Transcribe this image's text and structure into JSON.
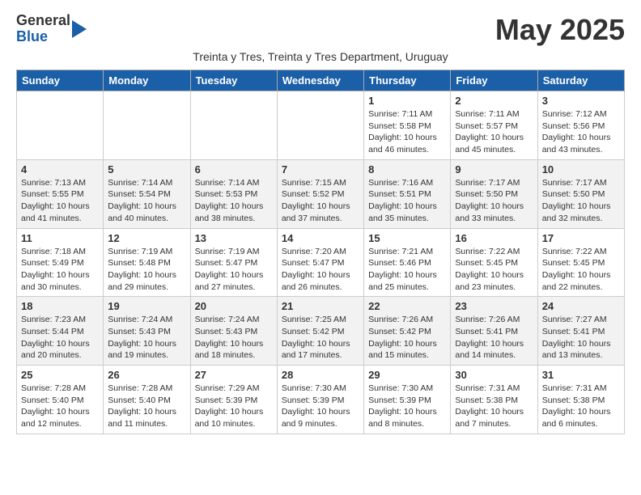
{
  "header": {
    "logo_general": "General",
    "logo_blue": "Blue",
    "month_title": "May 2025",
    "subtitle": "Treinta y Tres, Treinta y Tres Department, Uruguay"
  },
  "days_of_week": [
    "Sunday",
    "Monday",
    "Tuesday",
    "Wednesday",
    "Thursday",
    "Friday",
    "Saturday"
  ],
  "weeks": [
    [
      {
        "day": "",
        "info": ""
      },
      {
        "day": "",
        "info": ""
      },
      {
        "day": "",
        "info": ""
      },
      {
        "day": "",
        "info": ""
      },
      {
        "day": "1",
        "info": "Sunrise: 7:11 AM\nSunset: 5:58 PM\nDaylight: 10 hours\nand 46 minutes."
      },
      {
        "day": "2",
        "info": "Sunrise: 7:11 AM\nSunset: 5:57 PM\nDaylight: 10 hours\nand 45 minutes."
      },
      {
        "day": "3",
        "info": "Sunrise: 7:12 AM\nSunset: 5:56 PM\nDaylight: 10 hours\nand 43 minutes."
      }
    ],
    [
      {
        "day": "4",
        "info": "Sunrise: 7:13 AM\nSunset: 5:55 PM\nDaylight: 10 hours\nand 41 minutes."
      },
      {
        "day": "5",
        "info": "Sunrise: 7:14 AM\nSunset: 5:54 PM\nDaylight: 10 hours\nand 40 minutes."
      },
      {
        "day": "6",
        "info": "Sunrise: 7:14 AM\nSunset: 5:53 PM\nDaylight: 10 hours\nand 38 minutes."
      },
      {
        "day": "7",
        "info": "Sunrise: 7:15 AM\nSunset: 5:52 PM\nDaylight: 10 hours\nand 37 minutes."
      },
      {
        "day": "8",
        "info": "Sunrise: 7:16 AM\nSunset: 5:51 PM\nDaylight: 10 hours\nand 35 minutes."
      },
      {
        "day": "9",
        "info": "Sunrise: 7:17 AM\nSunset: 5:50 PM\nDaylight: 10 hours\nand 33 minutes."
      },
      {
        "day": "10",
        "info": "Sunrise: 7:17 AM\nSunset: 5:50 PM\nDaylight: 10 hours\nand 32 minutes."
      }
    ],
    [
      {
        "day": "11",
        "info": "Sunrise: 7:18 AM\nSunset: 5:49 PM\nDaylight: 10 hours\nand 30 minutes."
      },
      {
        "day": "12",
        "info": "Sunrise: 7:19 AM\nSunset: 5:48 PM\nDaylight: 10 hours\nand 29 minutes."
      },
      {
        "day": "13",
        "info": "Sunrise: 7:19 AM\nSunset: 5:47 PM\nDaylight: 10 hours\nand 27 minutes."
      },
      {
        "day": "14",
        "info": "Sunrise: 7:20 AM\nSunset: 5:47 PM\nDaylight: 10 hours\nand 26 minutes."
      },
      {
        "day": "15",
        "info": "Sunrise: 7:21 AM\nSunset: 5:46 PM\nDaylight: 10 hours\nand 25 minutes."
      },
      {
        "day": "16",
        "info": "Sunrise: 7:22 AM\nSunset: 5:45 PM\nDaylight: 10 hours\nand 23 minutes."
      },
      {
        "day": "17",
        "info": "Sunrise: 7:22 AM\nSunset: 5:45 PM\nDaylight: 10 hours\nand 22 minutes."
      }
    ],
    [
      {
        "day": "18",
        "info": "Sunrise: 7:23 AM\nSunset: 5:44 PM\nDaylight: 10 hours\nand 20 minutes."
      },
      {
        "day": "19",
        "info": "Sunrise: 7:24 AM\nSunset: 5:43 PM\nDaylight: 10 hours\nand 19 minutes."
      },
      {
        "day": "20",
        "info": "Sunrise: 7:24 AM\nSunset: 5:43 PM\nDaylight: 10 hours\nand 18 minutes."
      },
      {
        "day": "21",
        "info": "Sunrise: 7:25 AM\nSunset: 5:42 PM\nDaylight: 10 hours\nand 17 minutes."
      },
      {
        "day": "22",
        "info": "Sunrise: 7:26 AM\nSunset: 5:42 PM\nDaylight: 10 hours\nand 15 minutes."
      },
      {
        "day": "23",
        "info": "Sunrise: 7:26 AM\nSunset: 5:41 PM\nDaylight: 10 hours\nand 14 minutes."
      },
      {
        "day": "24",
        "info": "Sunrise: 7:27 AM\nSunset: 5:41 PM\nDaylight: 10 hours\nand 13 minutes."
      }
    ],
    [
      {
        "day": "25",
        "info": "Sunrise: 7:28 AM\nSunset: 5:40 PM\nDaylight: 10 hours\nand 12 minutes."
      },
      {
        "day": "26",
        "info": "Sunrise: 7:28 AM\nSunset: 5:40 PM\nDaylight: 10 hours\nand 11 minutes."
      },
      {
        "day": "27",
        "info": "Sunrise: 7:29 AM\nSunset: 5:39 PM\nDaylight: 10 hours\nand 10 minutes."
      },
      {
        "day": "28",
        "info": "Sunrise: 7:30 AM\nSunset: 5:39 PM\nDaylight: 10 hours\nand 9 minutes."
      },
      {
        "day": "29",
        "info": "Sunrise: 7:30 AM\nSunset: 5:39 PM\nDaylight: 10 hours\nand 8 minutes."
      },
      {
        "day": "30",
        "info": "Sunrise: 7:31 AM\nSunset: 5:38 PM\nDaylight: 10 hours\nand 7 minutes."
      },
      {
        "day": "31",
        "info": "Sunrise: 7:31 AM\nSunset: 5:38 PM\nDaylight: 10 hours\nand 6 minutes."
      }
    ]
  ]
}
